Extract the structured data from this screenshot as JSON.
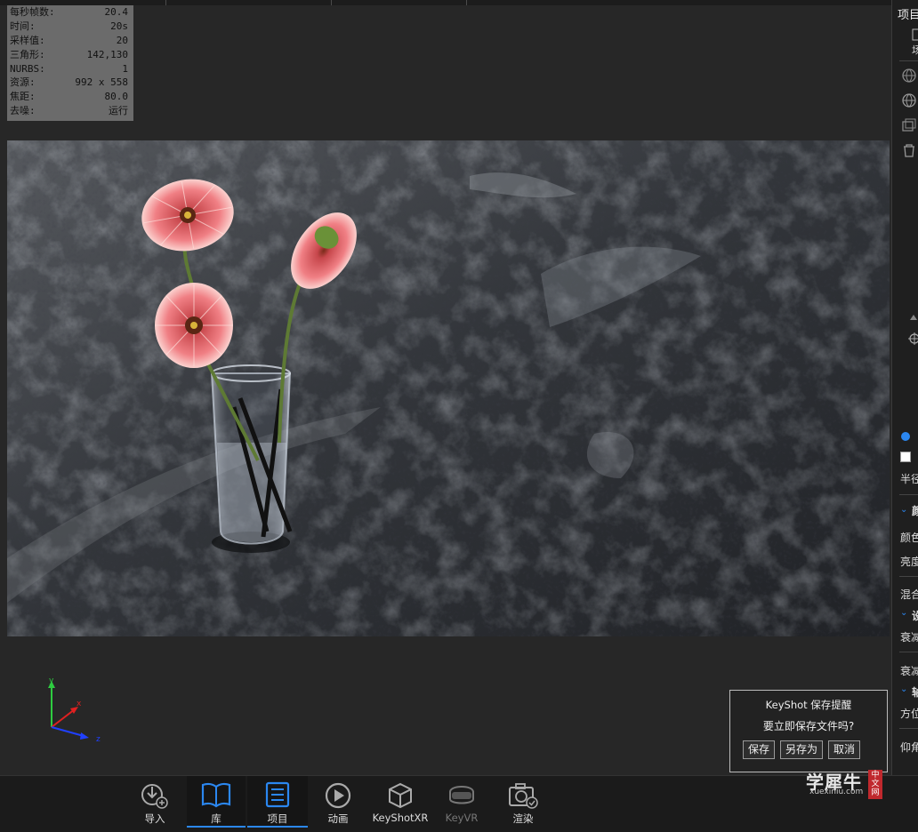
{
  "stats": [
    {
      "label": "每秒帧数:",
      "value": "20.4"
    },
    {
      "label": "时间:",
      "value": "20s"
    },
    {
      "label": "采样值:",
      "value": "20"
    },
    {
      "label": "三角形:",
      "value": "142,130"
    },
    {
      "label": "NURBS:",
      "value": "1"
    },
    {
      "label": "资源:",
      "value": "992 x 558"
    },
    {
      "label": "焦距:",
      "value": "80.0"
    },
    {
      "label": "去噪:",
      "value": "运行"
    }
  ],
  "axis": {
    "x": "x",
    "y": "y",
    "z": "z"
  },
  "dialog": {
    "title": "KeyShot 保存提醒",
    "message": "要立即保存文件吗?",
    "save": "保存",
    "save_as": "另存为",
    "cancel": "取消"
  },
  "right_panel": {
    "title": "项目",
    "tab": "场",
    "labels": [
      "半径",
      "颜色",
      "亮度",
      "混合",
      "衰减",
      "衰减",
      "方位",
      "仰角"
    ],
    "sections": [
      "颜",
      "设",
      "轴"
    ]
  },
  "toolbar": [
    {
      "label": "导入",
      "icon": "import-icon",
      "active": false,
      "disabled": false
    },
    {
      "label": "库",
      "icon": "library-icon",
      "active": true,
      "disabled": false
    },
    {
      "label": "项目",
      "icon": "project-icon",
      "active": true,
      "disabled": false
    },
    {
      "label": "动画",
      "icon": "animation-icon",
      "active": false,
      "disabled": false
    },
    {
      "label": "KeyShotXR",
      "icon": "keyshotxr-icon",
      "active": false,
      "disabled": false
    },
    {
      "label": "KeyVR",
      "icon": "keyvr-icon",
      "active": false,
      "disabled": true
    },
    {
      "label": "渲染",
      "icon": "render-icon",
      "active": false,
      "disabled": false
    }
  ],
  "watermark": {
    "main": "学犀牛",
    "sub": "xuexiniu.com",
    "badge": "中文网"
  },
  "colors": {
    "accent": "#2b87f0",
    "panel": "#1f1f1f",
    "viewport": "#272727"
  }
}
